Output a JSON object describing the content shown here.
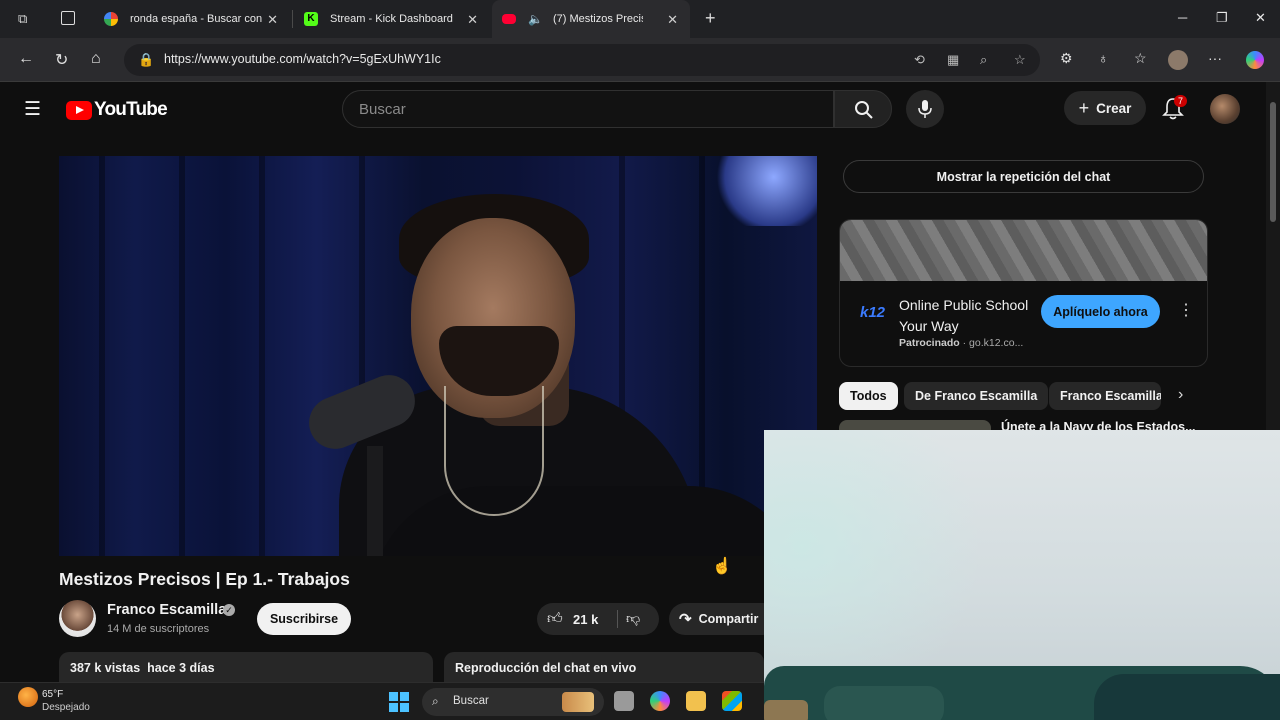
{
  "browser": {
    "tabs": [
      {
        "label": "ronda españa - Buscar con",
        "favicon": "google-icon"
      },
      {
        "label": "Stream - Kick Dashboard",
        "favicon": "kick-icon"
      },
      {
        "label": "(7) Mestizos Precis",
        "favicon": "youtube-icon"
      }
    ],
    "url": "https://www.youtube.com/watch?v=5gExUhWY1Ic"
  },
  "yt_header": {
    "logo_text": "YouTube",
    "search_placeholder": "Buscar",
    "create_label": "Crear",
    "notification_count": "7"
  },
  "video": {
    "title": "Mestizos Precisos | Ep 1.- Trabajos",
    "channel_name": "Franco Escamilla",
    "subscribers": "14 M de suscriptores",
    "subscribe_label": "Suscribirse",
    "likes": "21 k",
    "share_label": "Compartir",
    "views_date": "387 k vistas  hace 3 días",
    "chat_replay_label": "Reproducción del chat en vivo"
  },
  "sidebar": {
    "show_chat_label": "Mostrar la repetición del chat",
    "ad": {
      "logo": "k12",
      "title": "Online Public School Your Way",
      "sponsored": "Patrocinado",
      "domain": "go.k12.co...",
      "cta": "Aplíquelo ahora"
    },
    "chips": [
      "Todos",
      "De Franco Escamilla",
      "Franco Escamilla"
    ],
    "rec_title": "Únete a la Navy de los Estados..."
  },
  "taskbar": {
    "temp": "65°F",
    "condition": "Despejado",
    "search_label": "Buscar"
  },
  "colors": {
    "yt_red": "#ff0000",
    "accent_blue": "#3ea6ff",
    "background": "#0f0f0f"
  }
}
